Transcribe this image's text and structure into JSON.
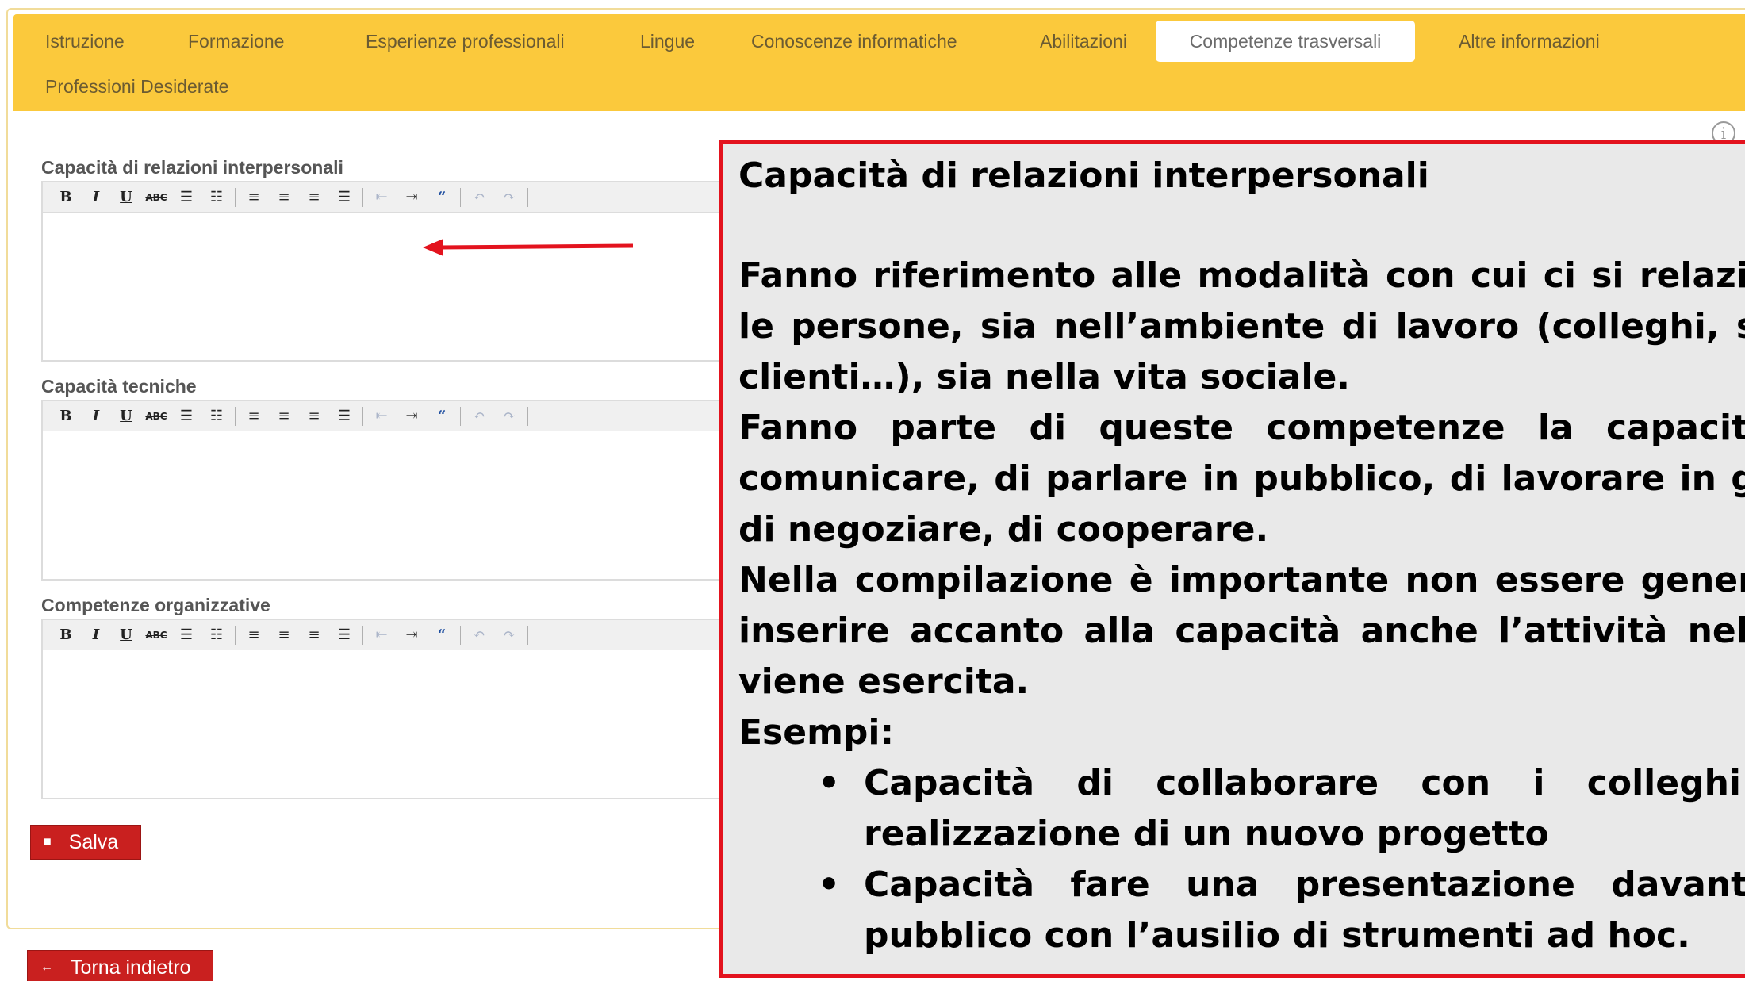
{
  "tabs": [
    {
      "label": "Istruzione"
    },
    {
      "label": "Formazione"
    },
    {
      "label": "Esperienze professionali"
    },
    {
      "label": "Lingue"
    },
    {
      "label": "Conoscenze informatiche"
    },
    {
      "label": "Abilitazioni"
    },
    {
      "label": "Competenze trasversali",
      "active": true
    },
    {
      "label": "Altre informazioni"
    },
    {
      "label": "Professioni Desiderate"
    }
  ],
  "fields": [
    {
      "label": "Capacità di relazioni interpersonali",
      "value": ""
    },
    {
      "label": "Capacità tecniche",
      "value": ""
    },
    {
      "label": "Competenze organizzative",
      "value": ""
    }
  ],
  "toolbar": {
    "bold": "B",
    "italic": "I",
    "underline": "U",
    "strike": "ABC",
    "quote": "“"
  },
  "info_icon": "i",
  "buttons": {
    "save_label": "Salva",
    "back_label": "Torna indietro",
    "back_arrow": "←"
  },
  "overlay": {
    "title": "Capacità di relazioni interpersonali",
    "lines": [
      "Fanno riferimento alle modalità con cui ci si relaziona con",
      "le persone, sia nell’ambiente di lavoro (colleghi, superiori,",
      "clienti…), sia nella vita sociale.",
      "Fanno parte di queste competenze la capacità di",
      "comunicare, di parlare in pubblico, di lavorare in gruppo,",
      "di negoziare, di cooperare.",
      "Nella compilazione è importante non essere generici ma",
      "inserire accanto alla capacità anche l’attività nella quale",
      "viene esercita.",
      "Esempi:"
    ],
    "bullets": [
      [
        "Capacità di collaborare con i colleghi nella",
        "realizzazione di un nuovo progetto"
      ],
      [
        "Capacità fare una presentazione davanti a un",
        "pubblico con l’ausilio di strumenti ad hoc."
      ]
    ]
  },
  "colors": {
    "tabbar": "#fbc93c",
    "button": "#c9201f",
    "overlay_border": "#e3131e",
    "overlay_bg": "#e9e9e9"
  }
}
